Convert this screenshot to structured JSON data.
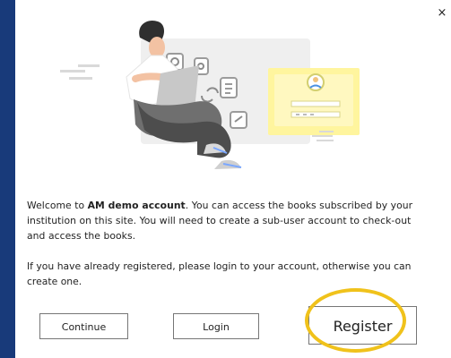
{
  "dialog": {
    "close_symbol": "×",
    "welcome_before": "Welcome to ",
    "welcome_bold": "AM demo account",
    "welcome_after": ". You can access the books subscribed by your institution on this site. You will need to create a sub-user account to check-out and access the books.",
    "registered_text": "If you have already registered, please login to your account, otherwise you can create one.",
    "buttons": {
      "continue_label": "Continue",
      "login_label": "Login",
      "register_label": "Register"
    }
  },
  "illustration": {
    "icon": "person-laptop-illustration"
  },
  "colors": {
    "page_background": "#183a7a",
    "highlight": "#f0c21b",
    "card_yellow": "#fff59e"
  }
}
